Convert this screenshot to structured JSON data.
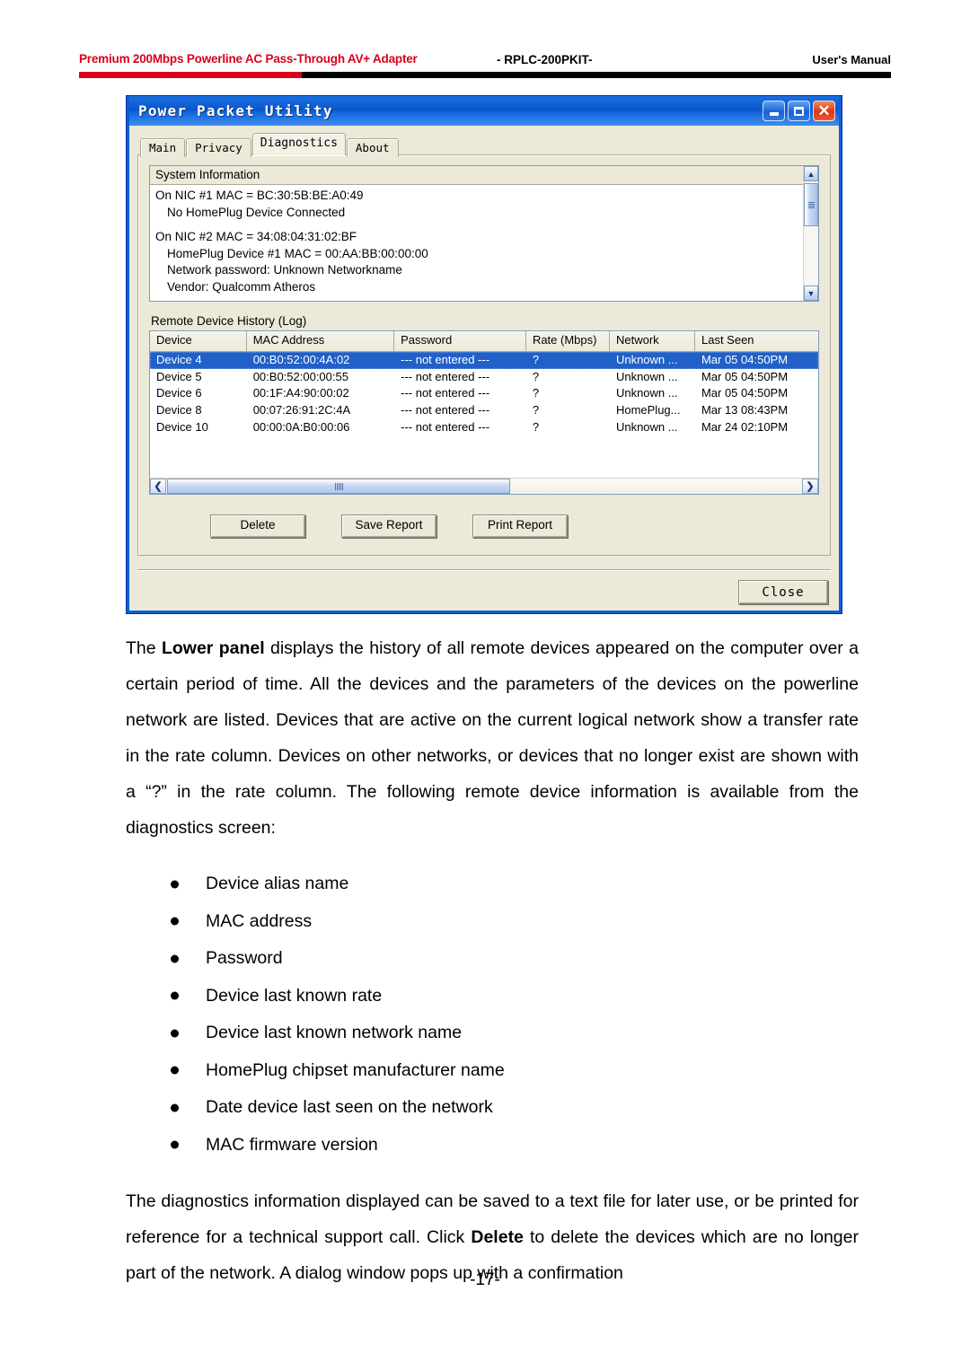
{
  "page_header": {
    "left_title": "Premium 200Mbps Powerline AC Pass-Through AV+ Adapter",
    "model": "- RPLC-200PKIT-",
    "right_title": "User's Manual",
    "rule_red": "#d9001b",
    "rule_black": "#000000"
  },
  "window": {
    "title": "Power Packet Utility",
    "controls": {
      "minimize": "_",
      "maximize": "□",
      "close": "✕"
    },
    "tabs": [
      {
        "label": "Main",
        "active": false
      },
      {
        "label": "Privacy",
        "active": false
      },
      {
        "label": "Diagnostics",
        "active": true
      },
      {
        "label": "About",
        "active": false
      }
    ],
    "system_information": {
      "header": "System Information",
      "lines": [
        "On NIC #1 MAC = BC:30:5B:BE:A0:49",
        "No HomePlug Device Connected",
        "",
        "On NIC #2 MAC = 34:08:04:31:02:BF",
        "HomePlug Device #1 MAC = 00:AA:BB:00:00:00",
        "Network password: Unknown Networkname",
        "Vendor: Qualcomm Atheros"
      ],
      "line_indent": [
        false,
        true,
        false,
        false,
        true,
        true,
        true
      ]
    },
    "remote_device_history": {
      "label": "Remote Device History (Log)",
      "columns": [
        "Device",
        "MAC Address",
        "Password",
        "Rate (Mbps)",
        "Network",
        "Last Seen"
      ],
      "rows": [
        {
          "device": "Device 4",
          "mac": "00:B0:52:00:4A:02",
          "password": "--- not entered ---",
          "rate": "?",
          "network": "Unknown ...",
          "last_seen": "Mar 05 04:50PM",
          "selected": true
        },
        {
          "device": "Device 5",
          "mac": "00:B0:52:00:00:55",
          "password": "--- not entered ---",
          "rate": "?",
          "network": "Unknown ...",
          "last_seen": "Mar 05 04:50PM",
          "selected": false
        },
        {
          "device": "Device 6",
          "mac": "00:1F:A4:90:00:02",
          "password": "--- not entered ---",
          "rate": "?",
          "network": "Unknown ...",
          "last_seen": "Mar 05 04:50PM",
          "selected": false
        },
        {
          "device": "Device 8",
          "mac": "00:07:26:91:2C:4A",
          "password": "--- not entered ---",
          "rate": "?",
          "network": "HomePlug...",
          "last_seen": "Mar 13 08:43PM",
          "selected": false
        },
        {
          "device": "Device 10",
          "mac": "00:00:0A:B0:00:06",
          "password": "--- not entered ---",
          "rate": "?",
          "network": "Unknown ...",
          "last_seen": "Mar 24 02:10PM",
          "selected": false
        }
      ]
    },
    "buttons": {
      "delete": "Delete",
      "save_report": "Save Report",
      "print_report": "Print Report",
      "close": "Close"
    },
    "selection_color": "#2060c8",
    "client_color": "#ece9d8",
    "titlebar_color": "#0a5fd4"
  },
  "document": {
    "paragraph1_pre": "The ",
    "paragraph1_bold": "Lower panel",
    "paragraph1_post": " displays the history of all remote devices appeared on the computer over a certain period of time. All the devices and the parameters of the devices on the powerline network are listed. Devices that are active on the current logical network show a transfer rate in the rate column. Devices on other networks, or devices that no longer exist are shown with a “?” in the rate column. The following remote device information is available from the diagnostics screen:",
    "bullets": [
      "Device alias name",
      "MAC address",
      "Password",
      "Device last known rate",
      "Device last known network name",
      "HomePlug chipset manufacturer name",
      "Date device last seen on the network",
      "MAC firmware version"
    ],
    "paragraph2_pre": "The diagnostics information displayed can be saved to a text file for later use, or be printed for reference for a technical support call. Click ",
    "paragraph2_bold": "Delete",
    "paragraph2_post": " to delete the devices which are no longer part of the network. A dialog window pops up with a confirmation",
    "page_number": "-17-"
  }
}
